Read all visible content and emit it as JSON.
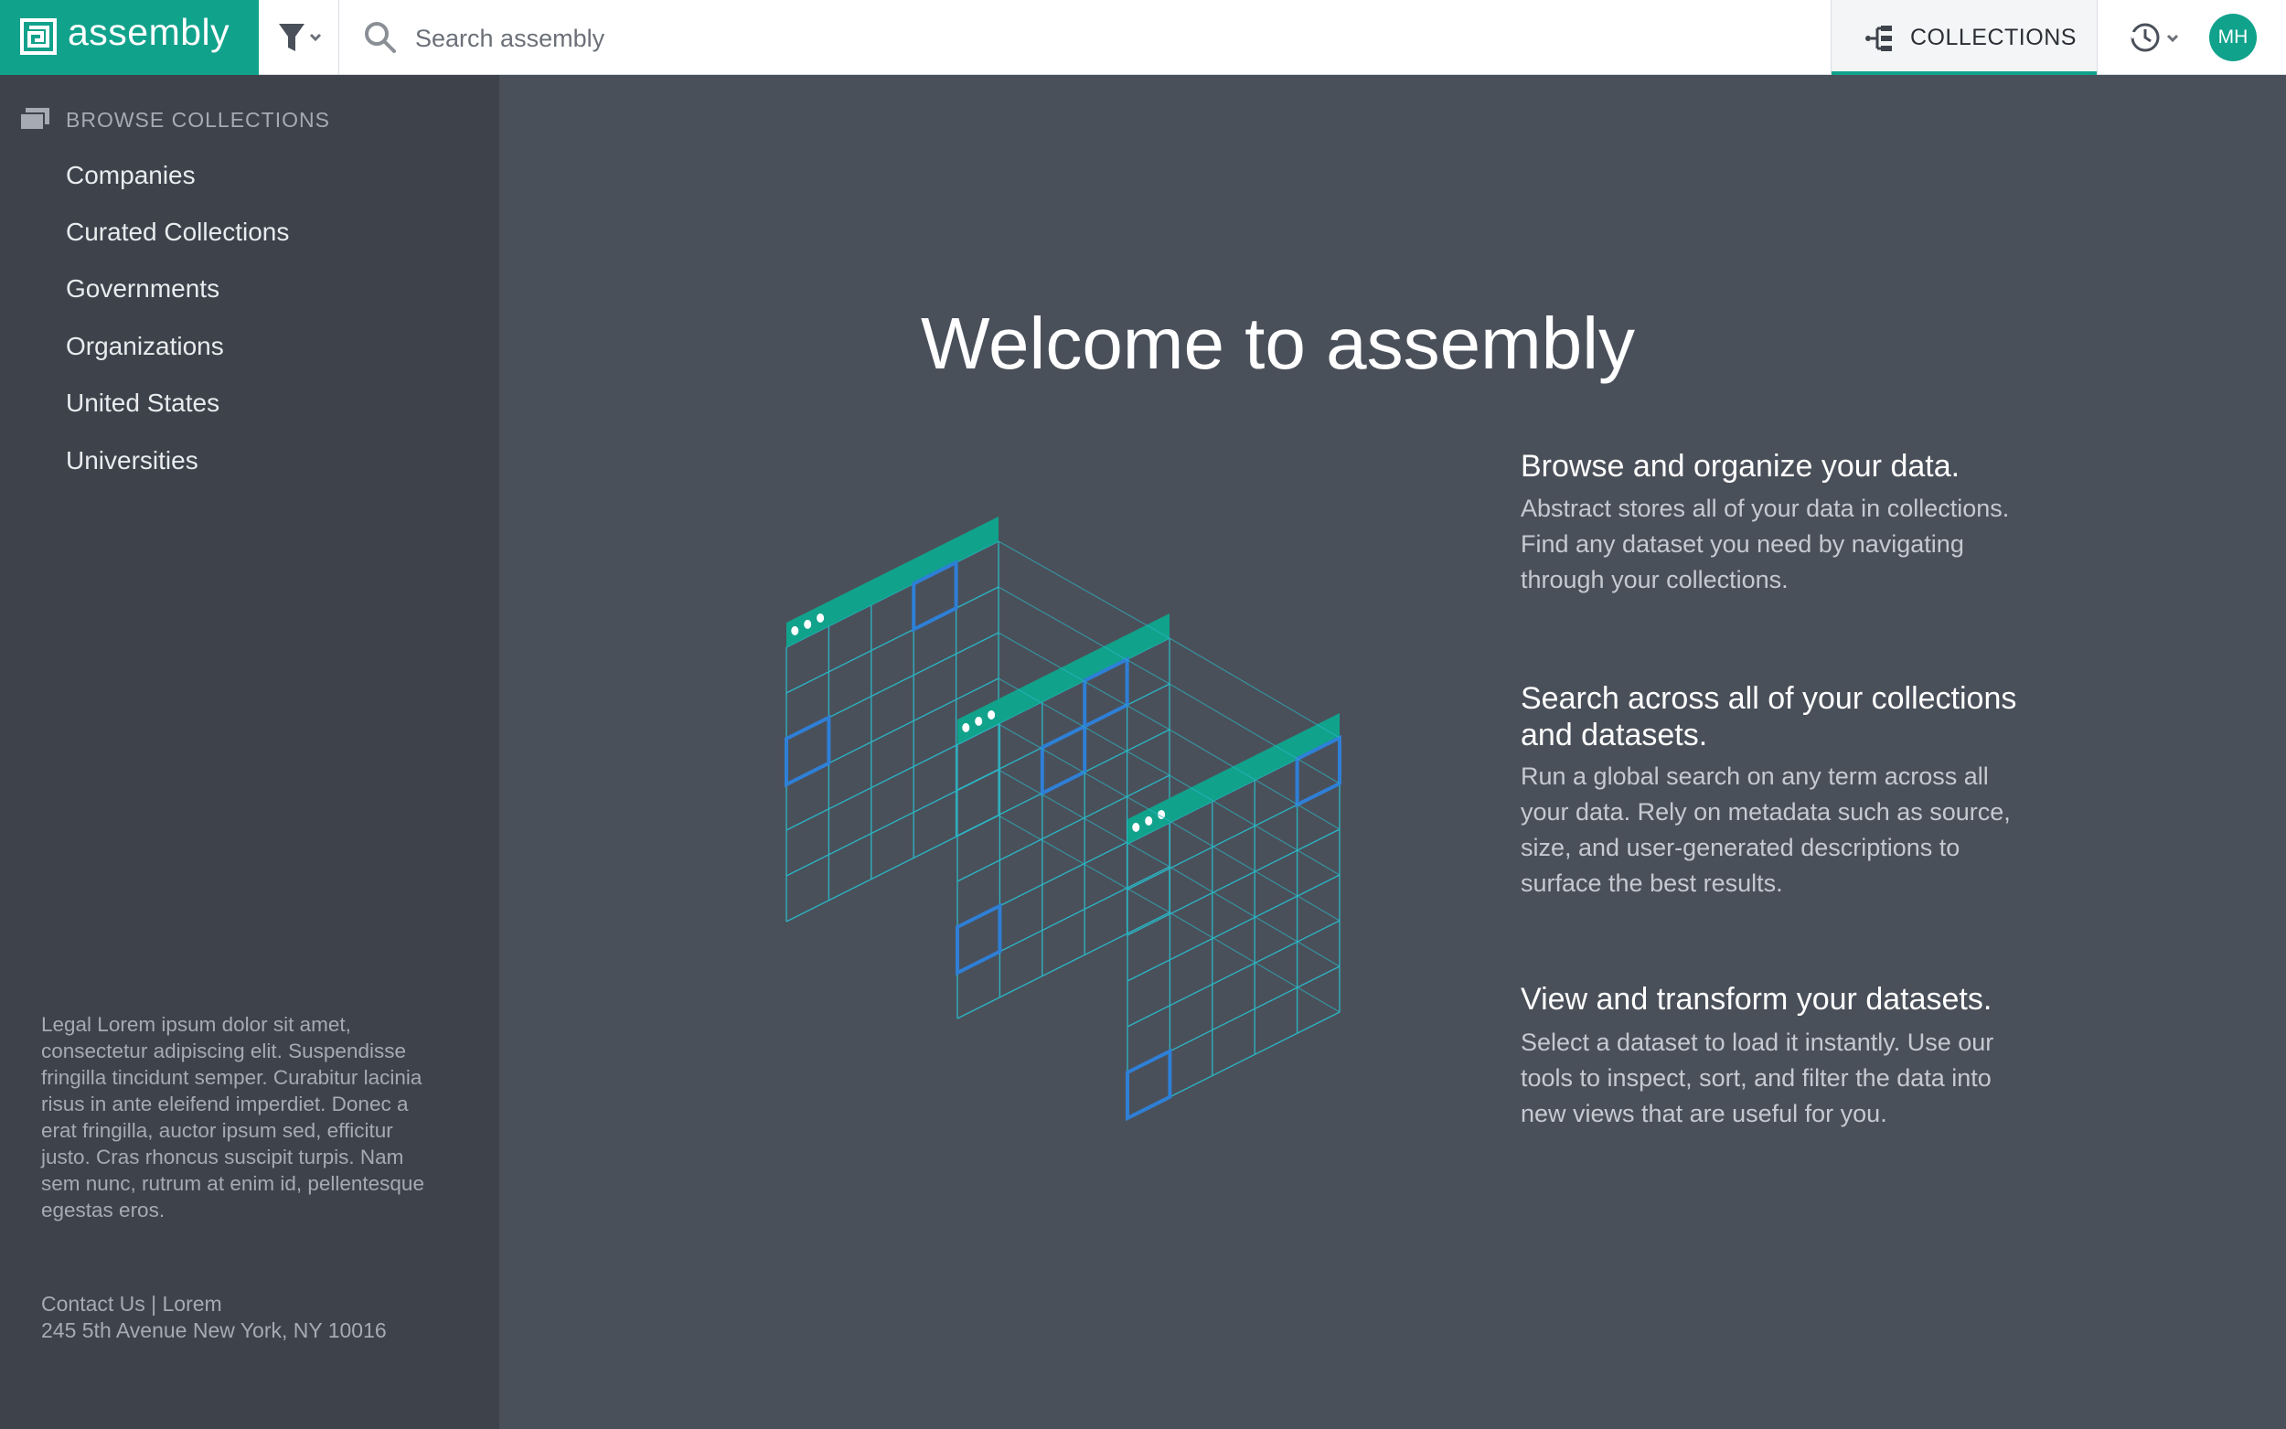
{
  "brand": {
    "name": "assembly",
    "color": "#11a28c"
  },
  "search": {
    "placeholder": "Search assembly"
  },
  "header": {
    "collections_label": "COLLECTIONS",
    "avatar_initials": "MH"
  },
  "sidebar": {
    "header": "BROWSE COLLECTIONS",
    "items": [
      {
        "label": "Companies"
      },
      {
        "label": "Curated Collections"
      },
      {
        "label": "Governments"
      },
      {
        "label": "Organizations"
      },
      {
        "label": "United States"
      },
      {
        "label": "Universities"
      }
    ],
    "legal": "Legal Lorem ipsum dolor sit amet, consectetur adipiscing elit. Suspendisse fringilla tincidunt semper. Curabitur lacinia risus in ante eleifend imperdiet. Donec a erat fringilla, auctor ipsum sed, efficitur justo. Cras rhoncus suscipit turpis. Nam sem nunc, rutrum at enim id, pellentesque egestas eros.",
    "contact_line1": "Contact Us | Lorem",
    "contact_line2": "245 5th Avenue New York, NY 10016"
  },
  "main": {
    "title": "Welcome to assembly",
    "features": [
      {
        "title": "Browse and organize your data.",
        "description": "Abstract stores all of your data in collections. Find any dataset you need by navigating through your collections."
      },
      {
        "title": "Search across all of your collections and datasets.",
        "description": "Run a global search on any term across all your data. Rely on metadata such as source, size, and user-generated descriptions to surface the best results."
      },
      {
        "title": "View and transform your datasets.",
        "description": "Select a dataset to load it instantly. Use our tools to inspect, sort, and filter the data into new views that are useful for you."
      }
    ]
  },
  "icons": {
    "brand": "assembly-logo-icon",
    "filter": "filter-icon",
    "search": "search-icon",
    "collections": "collections-tree-icon",
    "history": "history-icon",
    "browse": "folders-icon"
  },
  "colors": {
    "accent": "#11a28c",
    "sidebar": "#3d424b",
    "main_bg": "#4a505a",
    "illustration_line": "#2bb5c4",
    "illustration_cell": "#2e7fd6"
  }
}
